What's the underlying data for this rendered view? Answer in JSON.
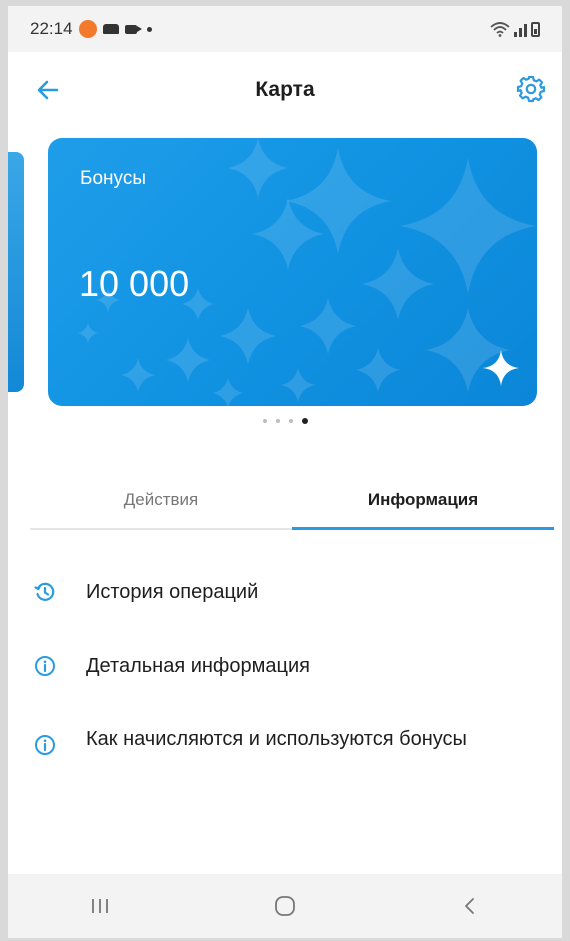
{
  "status_bar": {
    "time": "22:14"
  },
  "app_bar": {
    "title": "Карта",
    "back_icon": "arrow-left-icon",
    "settings_icon": "gear-icon"
  },
  "card": {
    "label": "Бонусы",
    "value": "10 000",
    "background_color": "#1294e3"
  },
  "pager": {
    "pages": 4,
    "active_index": 3
  },
  "tabs": [
    {
      "label": "Действия",
      "active": false
    },
    {
      "label": "Информация",
      "active": true
    }
  ],
  "menu": [
    {
      "label": "История операций",
      "icon": "history-icon"
    },
    {
      "label": "Детальная информация",
      "icon": "info-icon"
    },
    {
      "label": "Как начисляются и используются бонусы",
      "icon": "info-icon"
    }
  ],
  "colors": {
    "accent": "#2a9be0",
    "card": "#1294e3"
  }
}
